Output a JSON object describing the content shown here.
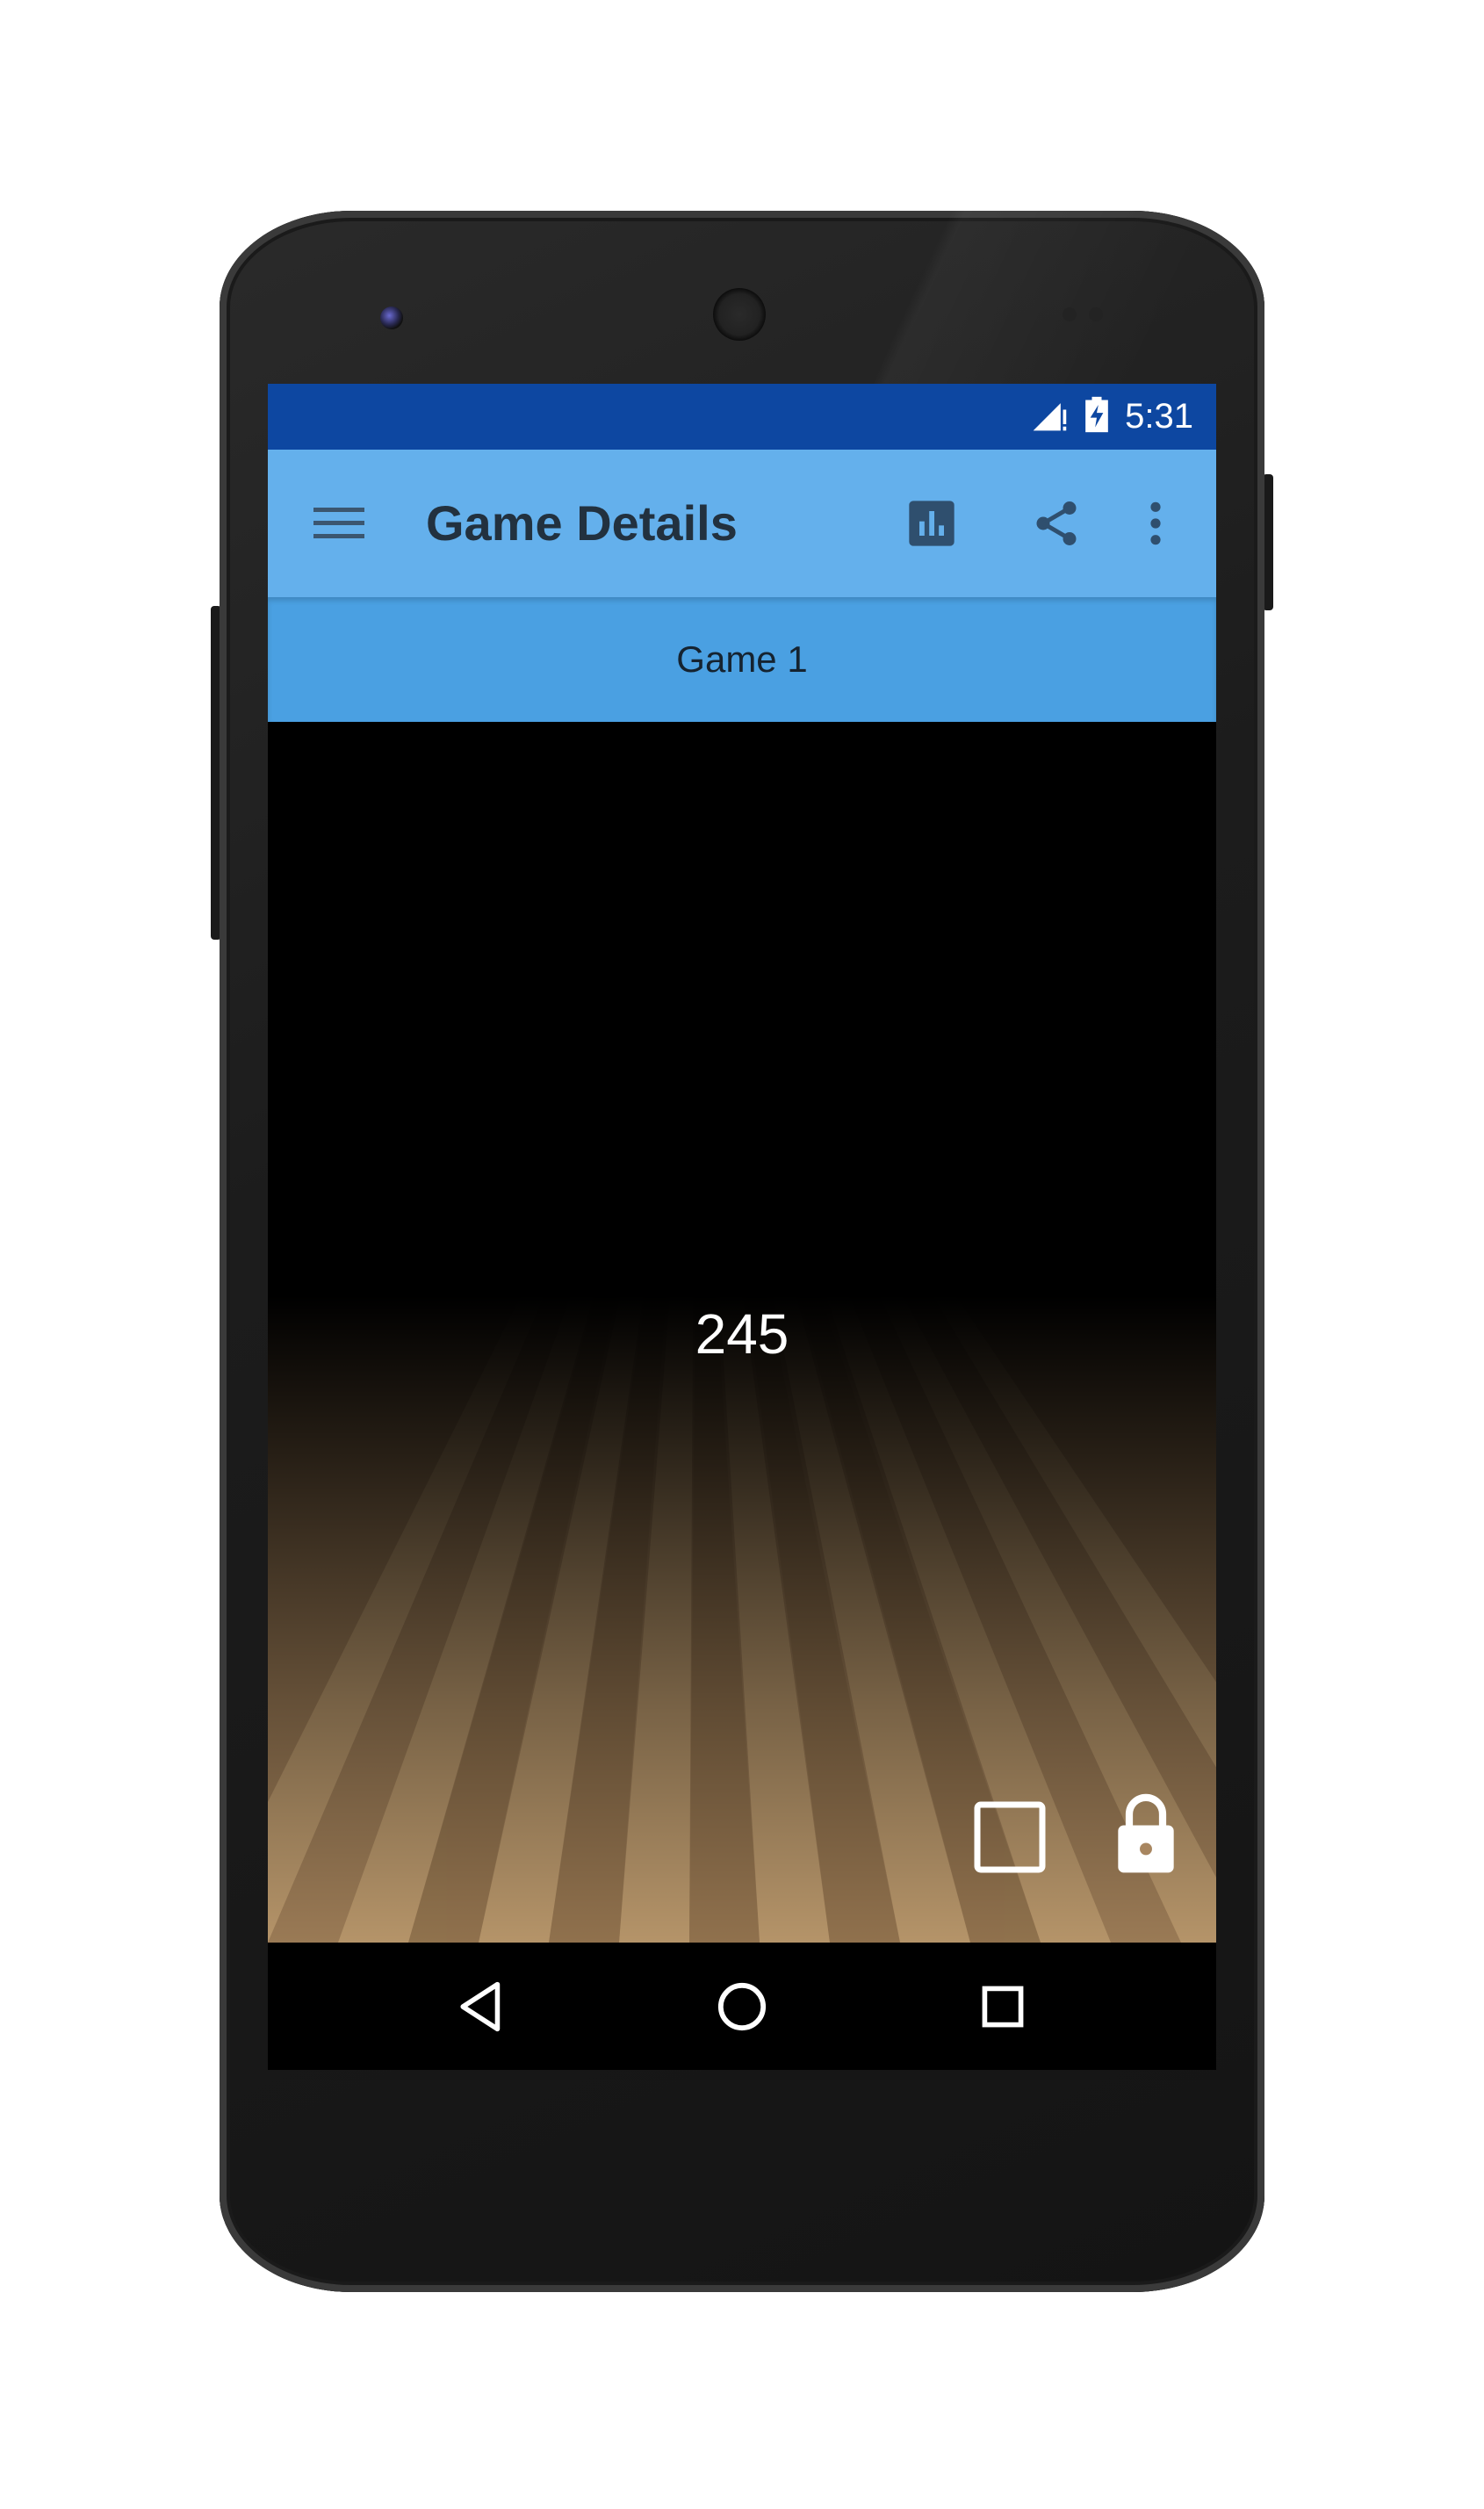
{
  "status_bar": {
    "time": "5:31",
    "icons": [
      "signal-icon",
      "battery-charging-icon"
    ]
  },
  "toolbar": {
    "title": "Game Details",
    "actions": [
      "bar-chart-icon",
      "share-icon",
      "more-vert-icon"
    ]
  },
  "tabs": [
    {
      "label": "Game 1"
    }
  ],
  "game": {
    "score": "245"
  },
  "controls": [
    "square-icon",
    "lock-icon"
  ],
  "nav_bar": [
    "back-icon",
    "home-icon",
    "recents-icon"
  ],
  "colors": {
    "status_bar": "#0d47a1",
    "toolbar": "#64b0ec",
    "tab_bar": "#4aa0e2",
    "title_text": "#22313f",
    "lane_wood": "#a88660"
  }
}
